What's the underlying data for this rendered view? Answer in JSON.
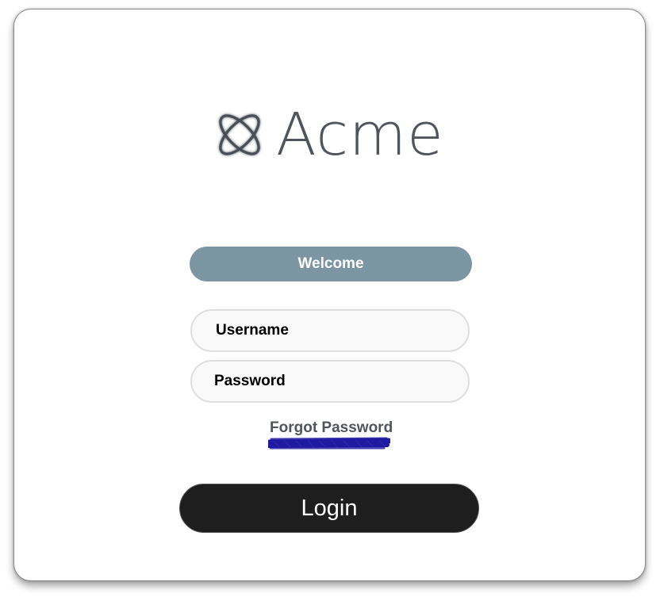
{
  "brand": {
    "name": "Acme",
    "icon": "orbit-logo-icon",
    "text_color": "#50545c"
  },
  "banner": {
    "label": "Welcome",
    "color": "#7b95a3"
  },
  "form": {
    "username_placeholder": "Username",
    "password_placeholder": "Password",
    "forgot_label": "Forgot Password",
    "login_label": "Login",
    "login_color": "#1e1e1e"
  },
  "annotation": {
    "underline_scribble_color": "#1f1aa0"
  }
}
